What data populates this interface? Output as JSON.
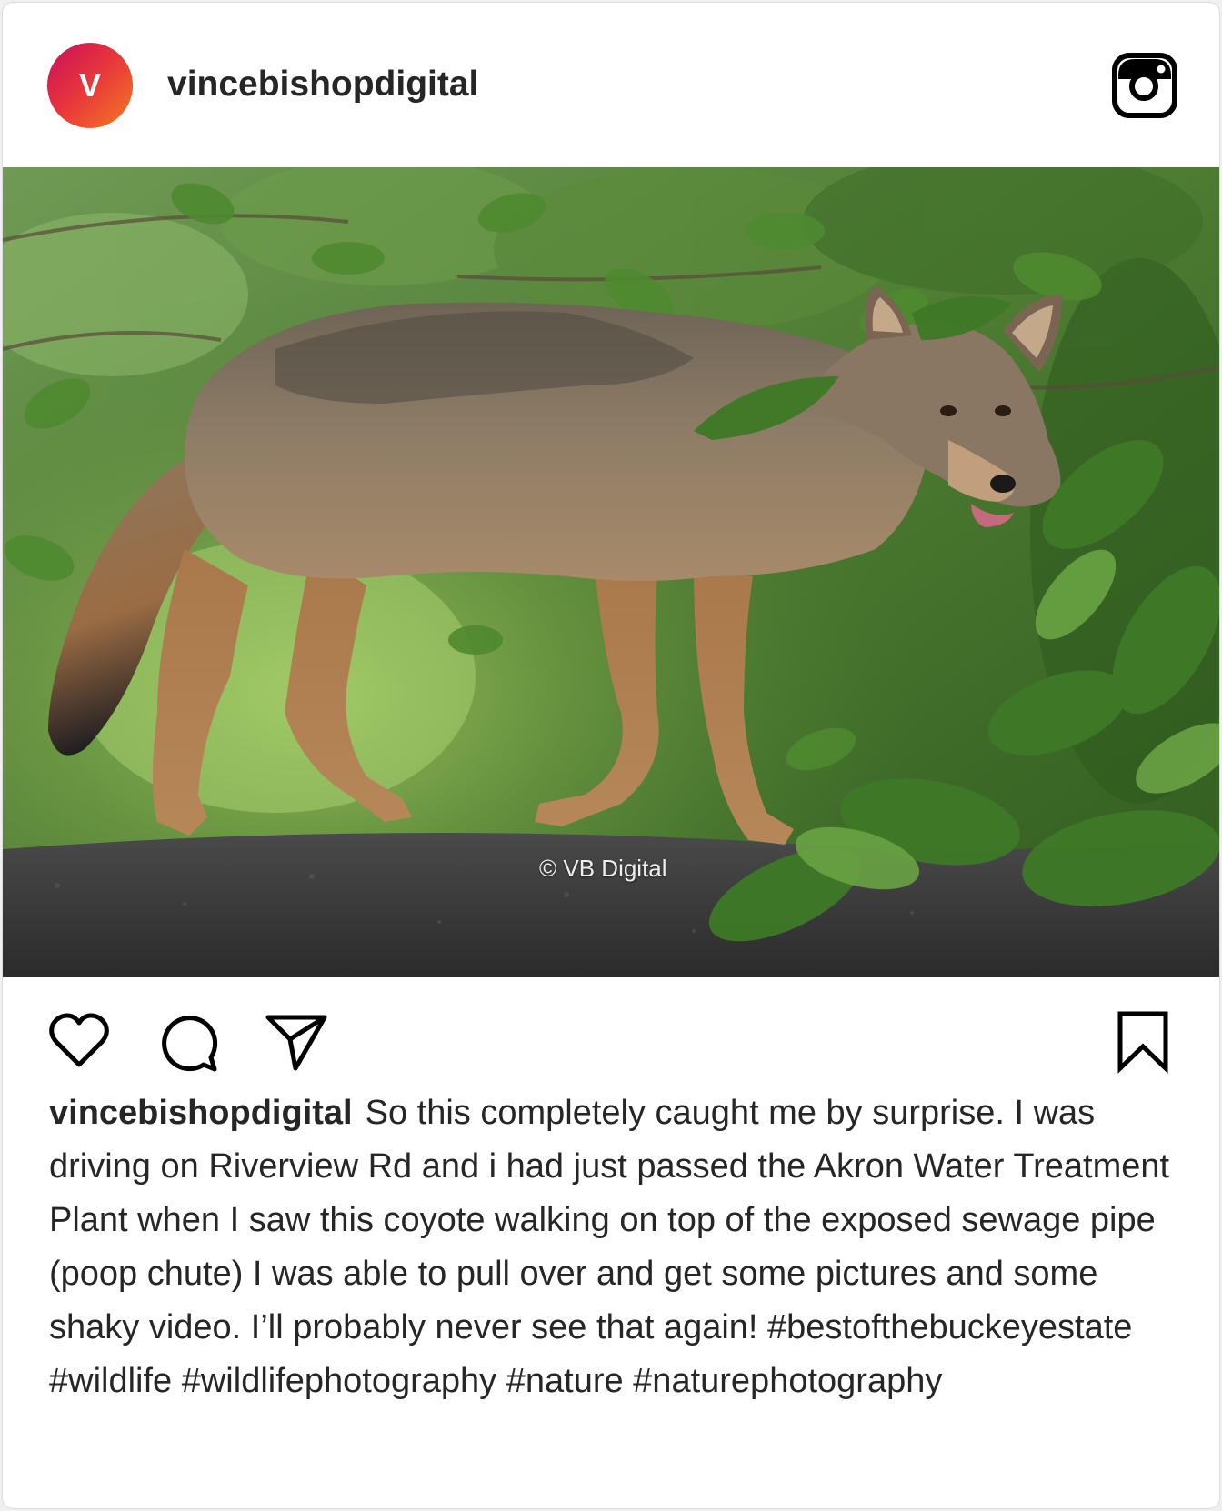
{
  "post": {
    "avatar_letter": "V",
    "username": "vincebishopdigital",
    "platform_icon": "instagram-icon",
    "photo": {
      "subject": "coyote",
      "watermark": "© VB Digital"
    },
    "actions": {
      "like_icon": "heart-outline-icon",
      "comment_icon": "speech-bubble-icon",
      "share_icon": "paper-plane-icon",
      "save_icon": "bookmark-outline-icon"
    },
    "caption": {
      "username": "vincebishopdigital",
      "text": "So this completely caught me by surprise. I was driving on Riverview Rd and i had just passed the Akron Water Treatment Plant when I saw this coyote walking on top of the exposed sewage pipe (poop chute) I was able to pull over and get some pictures and some shaky video. I’ll probably never see that again! #bestofthebuckeyestate #wildlife #wildlifephotography #nature #naturephotography"
    }
  },
  "colors": {
    "avatar_gradient_start": "#c90f5a",
    "avatar_gradient_end": "#f47b22",
    "text": "#262626",
    "border": "#dbdbdb",
    "background": "#ffffff"
  }
}
